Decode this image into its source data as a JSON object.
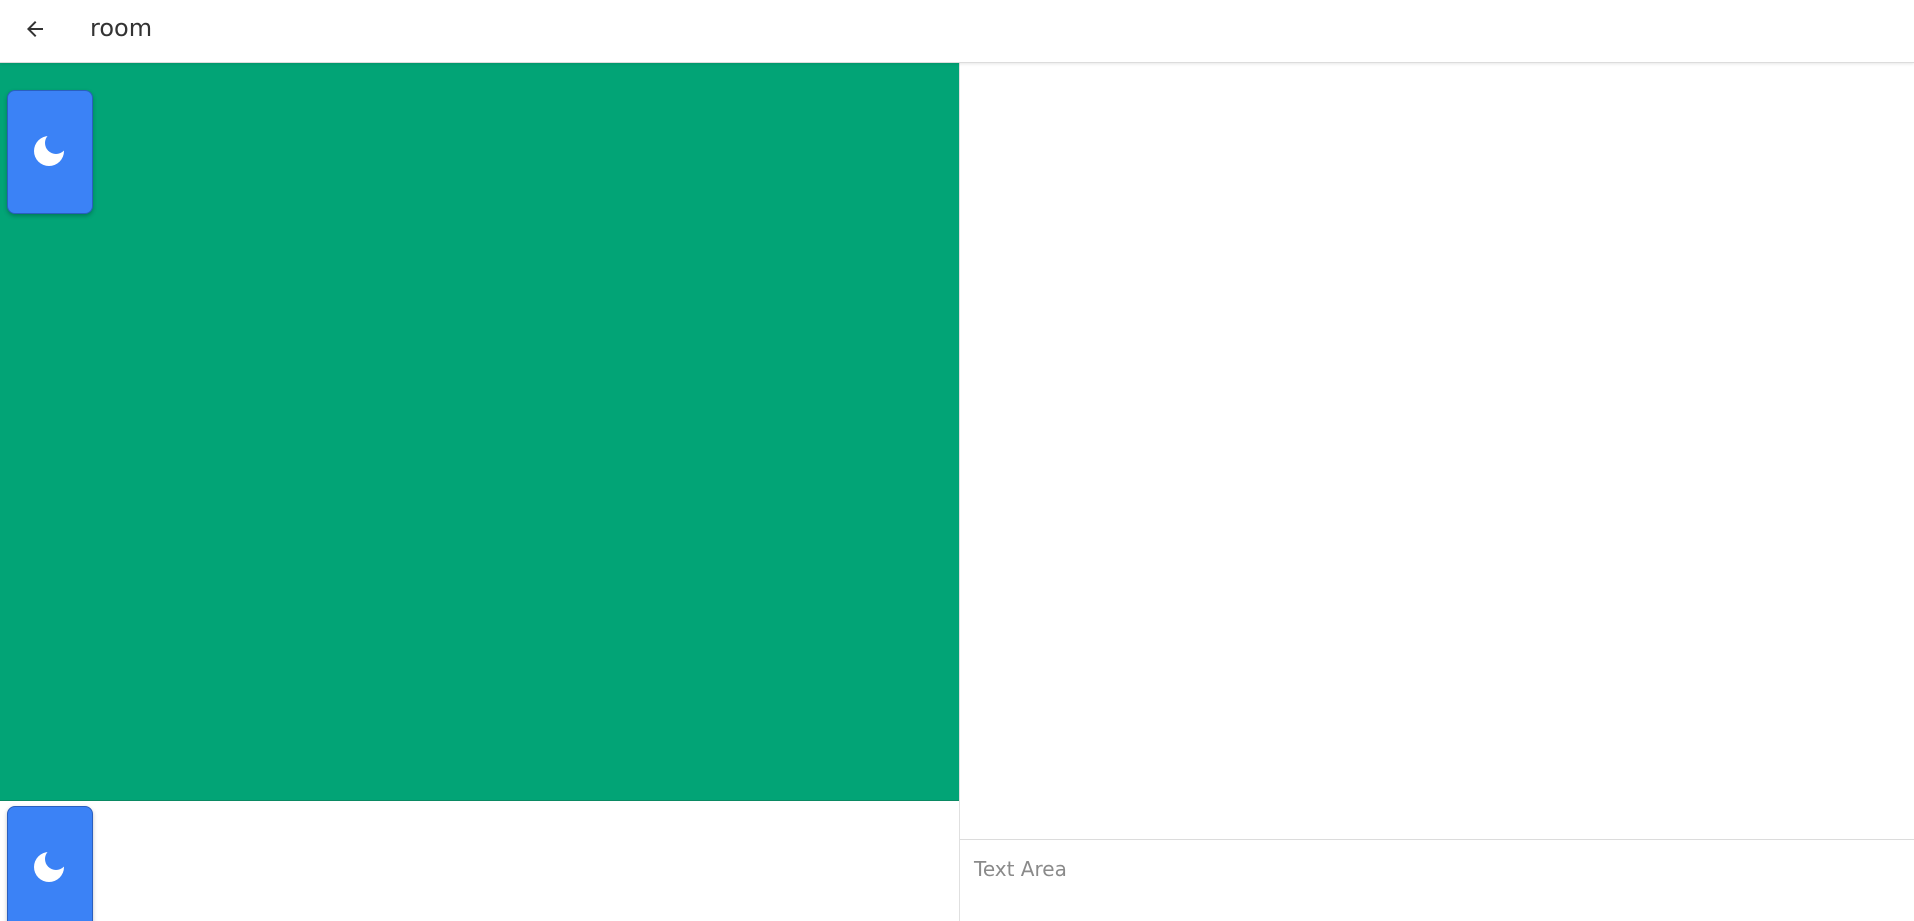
{
  "header": {
    "back_icon": "arrow-left-icon",
    "title": "room"
  },
  "game": {
    "table_color": "#02a476",
    "card_color": "#3b82f6",
    "card_icon": "moon-icon"
  },
  "chat": {
    "input_placeholder": "Text Area",
    "input_value": ""
  }
}
